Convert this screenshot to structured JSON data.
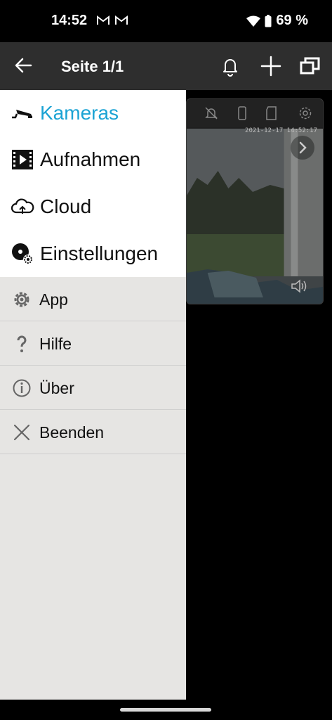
{
  "status_bar": {
    "time": "14:52",
    "battery_text": "69 %",
    "icons": [
      "gmail-icon",
      "gmail-icon",
      "wifi-icon",
      "battery-icon"
    ]
  },
  "app_bar": {
    "title": "Seite 1/1",
    "icons": [
      "back-arrow-icon",
      "bell-icon",
      "plus-icon",
      "multi-window-icon"
    ]
  },
  "camera_panel": {
    "timestamp": "2021-12-17  14:52:17",
    "toolbar_icons": [
      "bell-off-icon",
      "phone-icon",
      "sd-card-icon",
      "gear-icon"
    ]
  },
  "drawer": {
    "main_items": [
      {
        "label": "Kameras",
        "icon": "cctv-camera-icon",
        "active": true
      },
      {
        "label": "Aufnahmen",
        "icon": "film-icon",
        "active": false
      },
      {
        "label": "Cloud",
        "icon": "cloud-icon",
        "active": false
      },
      {
        "label": "Einstellungen",
        "icon": "disk-settings-icon",
        "active": false
      }
    ],
    "sub_items": [
      {
        "label": "App",
        "icon": "gear-icon"
      },
      {
        "label": "Hilfe",
        "icon": "question-icon"
      },
      {
        "label": "Über",
        "icon": "info-icon"
      },
      {
        "label": "Beenden",
        "icon": "close-icon"
      }
    ]
  },
  "colors": {
    "accent": "#1ba3d4",
    "appbar": "#2e2e2e",
    "drawer_bg": "#e6e5e3"
  }
}
